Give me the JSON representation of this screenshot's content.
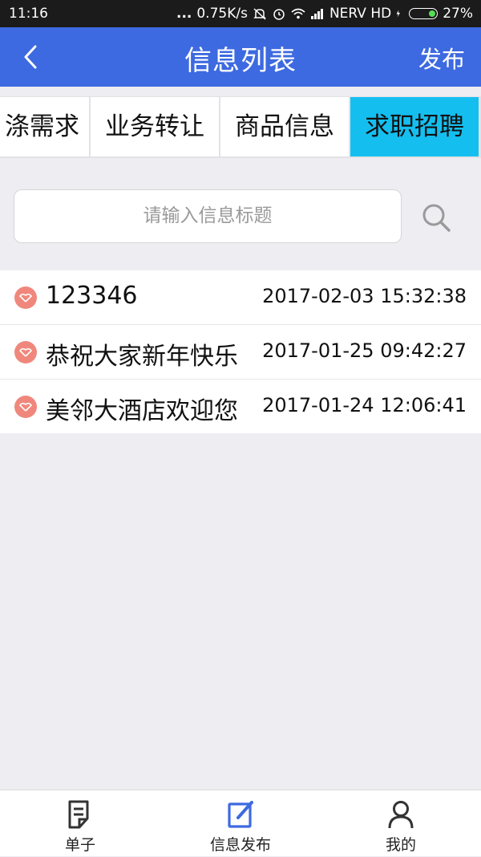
{
  "status_bar": {
    "time": "11:16",
    "dots": "...",
    "speed": "0.75K/s",
    "carrier": "NERV HD",
    "battery": "27%",
    "battery_level": 0.27
  },
  "header": {
    "title": "信息列表",
    "publish_label": "发布",
    "back_icon": "chevron-left-icon"
  },
  "tabs": [
    {
      "label": "涤需求",
      "active": false
    },
    {
      "label": "业务转让",
      "active": false
    },
    {
      "label": "商品信息",
      "active": false
    },
    {
      "label": "求职招聘",
      "active": true
    }
  ],
  "search": {
    "placeholder": "请输入信息标题",
    "icon": "search-icon"
  },
  "list": [
    {
      "title": "123346",
      "date": "2017-02-03 15:32:38"
    },
    {
      "title": "恭祝大家新年快乐",
      "date": "2017-01-25 09:42:27"
    },
    {
      "title": "美邻大酒店欢迎您",
      "date": "2017-01-24 12:06:41"
    }
  ],
  "bottom_nav": [
    {
      "label": "单子",
      "icon": "document-icon",
      "active": false
    },
    {
      "label": "信息发布",
      "icon": "edit-icon",
      "active": true
    },
    {
      "label": "我的",
      "icon": "user-icon",
      "active": false
    }
  ],
  "colors": {
    "header": "#3d6ae0",
    "active_tab": "#14bff0",
    "active_nav_icon": "#3d6ae0",
    "list_icon": "#f0877c"
  }
}
